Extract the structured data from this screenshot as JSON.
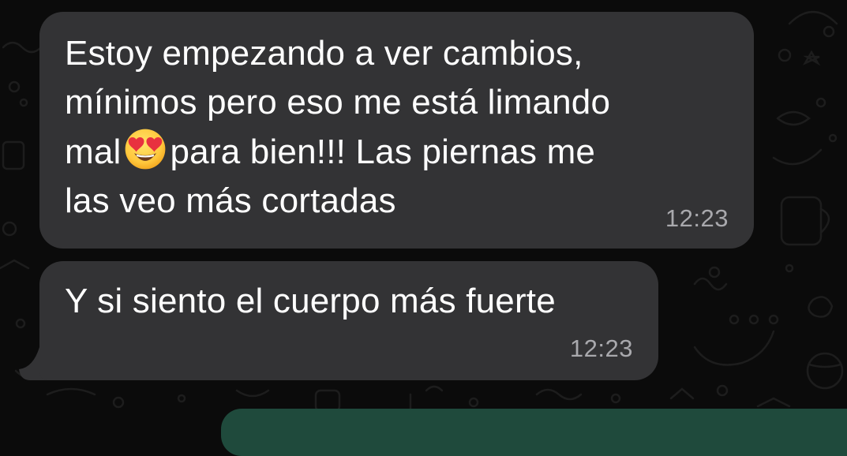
{
  "colors": {
    "background": "#0b0b0b",
    "incoming_bubble": "#333335",
    "text": "#ffffff",
    "timestamp": "#a9a9ad",
    "outgoing_bubble": "#1f4a3c"
  },
  "messages": [
    {
      "text_before_emoji": "Estoy empezando a ver cambios,\nmínimos pero eso me está limando\nmal",
      "emoji": "smiling-face-with-heart-eyes",
      "text_after_emoji": "para bien!!!  Las piernas me\nlas veo más cortadas",
      "time": "12:23"
    },
    {
      "text": "Y si siento el cuerpo más fuerte",
      "time": "12:23"
    }
  ]
}
